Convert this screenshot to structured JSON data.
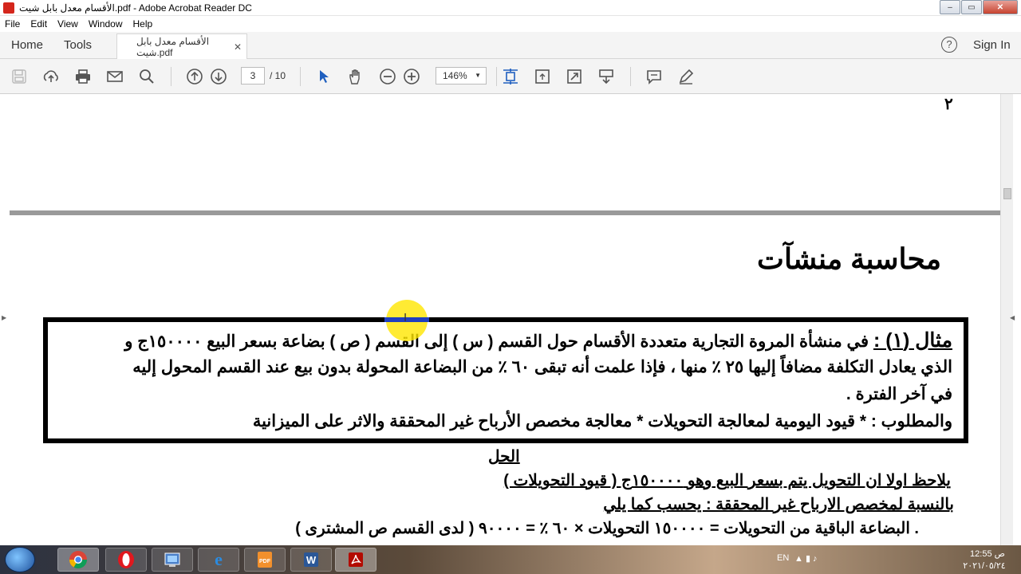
{
  "window": {
    "title": "الأقسام معدل بابل شيت.pdf - Adobe Acrobat Reader DC",
    "controls": [
      "–",
      "▭",
      "✕"
    ]
  },
  "menu": [
    "File",
    "Edit",
    "View",
    "Window",
    "Help"
  ],
  "tabs": {
    "home": "Home",
    "tools": "Tools",
    "document": "الأقسام معدل بابل شيت.pdf",
    "sign_in": "Sign In"
  },
  "toolbar": {
    "current_page": "3",
    "total_pages": "/ 10",
    "zoom": "146%"
  },
  "document": {
    "prev_page_number": "٢",
    "heading": "محاسبة منشآت",
    "example": {
      "line1_label": "مثال (١) :",
      "line1": "في منشأة المروة التجارية متعددة الأقسام حول القسم ( س ) إلى القسم ( ص ) بضاعة بسعر البيع ١٥٠٠٠٠ج و",
      "line2": "الذي يعادل التكلفة مضافاً إليها ٢٥ ٪ منها ، فإذا علمت أنه تبقى ٦٠ ٪ من البضاعة المحولة بدون بيع عند القسم المحول إليه",
      "line3": "في آخر الفترة .",
      "line4": "والمطلوب : * قيود اليومية لمعالجة التحويلات * معالجة مخصص الأرباح غير المحققة والاثر على الميزانية"
    },
    "solution": {
      "title": "الحل",
      "line1": "يلاحظ اولا ان التحويل يتم بسعر البيع وهو ١٥٠٠٠٠ج ( قيود التحويلات )",
      "line2": "بالنسبة لمخصص الارباح غير المحققة : يحسب كما يلي",
      "line3": ". البضاعة الباقية من التحويلات = ١٥٠٠٠٠ التحويلات × ٦٠ ٪ = ٩٠٠٠٠ ( لدى القسم ص المشترى )"
    }
  },
  "taskbar": {
    "apps": [
      "chrome-icon",
      "opera-icon",
      "control-panel-icon",
      "ie-icon",
      "pdf-converter-icon",
      "word-icon",
      "acrobat-icon"
    ],
    "language": "EN",
    "time": "12:55 ص",
    "date": "٢٠٢١/٠٥/٢٤"
  }
}
